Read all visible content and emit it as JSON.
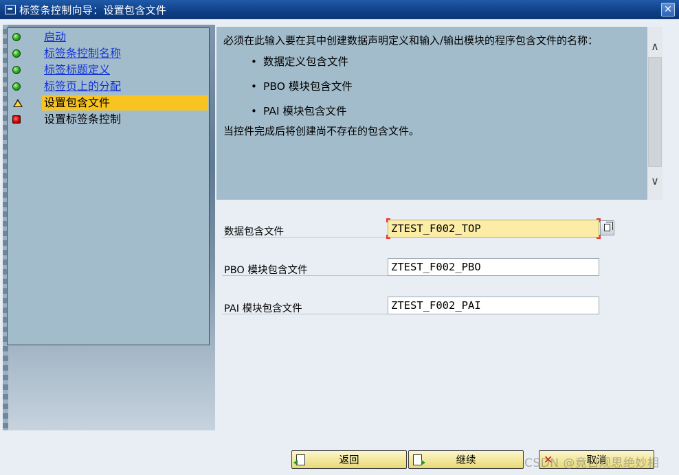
{
  "window": {
    "title": "标签条控制向导：设置包含文件",
    "close_label": "✕"
  },
  "steps": [
    {
      "label": "启动",
      "status": "done"
    },
    {
      "label": "标签条控制名称",
      "status": "done"
    },
    {
      "label": "标签标题定义",
      "status": "done"
    },
    {
      "label": "标签页上的分配",
      "status": "done"
    },
    {
      "label": "设置包含文件",
      "status": "current"
    },
    {
      "label": "设置标签条控制",
      "status": "todo"
    }
  ],
  "info": {
    "intro": "必须在此输入要在其中创建数据声明定义和输入/输出模块的程序包含文件的名称：",
    "bullets": [
      "数据定义包含文件",
      "PBO 模块包含文件",
      "PAI 模块包含文件"
    ],
    "outro": "当控件完成后将创建尚不存在的包含文件。"
  },
  "form": {
    "data_label": "数据包含文件",
    "data_value": "ZTEST_F002_TOP",
    "pbo_label": "PBO 模块包含文件",
    "pbo_value": "ZTEST_F002_PBO",
    "pai_label": "PAI 模块包含文件",
    "pai_value": "ZTEST_F002_PAI"
  },
  "buttons": {
    "back": "返回",
    "continue": "继续",
    "cancel": "取消"
  },
  "watermark": "CSDN @竟日观思绝妙相",
  "colors": {
    "titlebar": "#0f3f86",
    "nav_bg": "#a3bccc",
    "current_step": "#f9c41f",
    "link": "#1233d6"
  }
}
